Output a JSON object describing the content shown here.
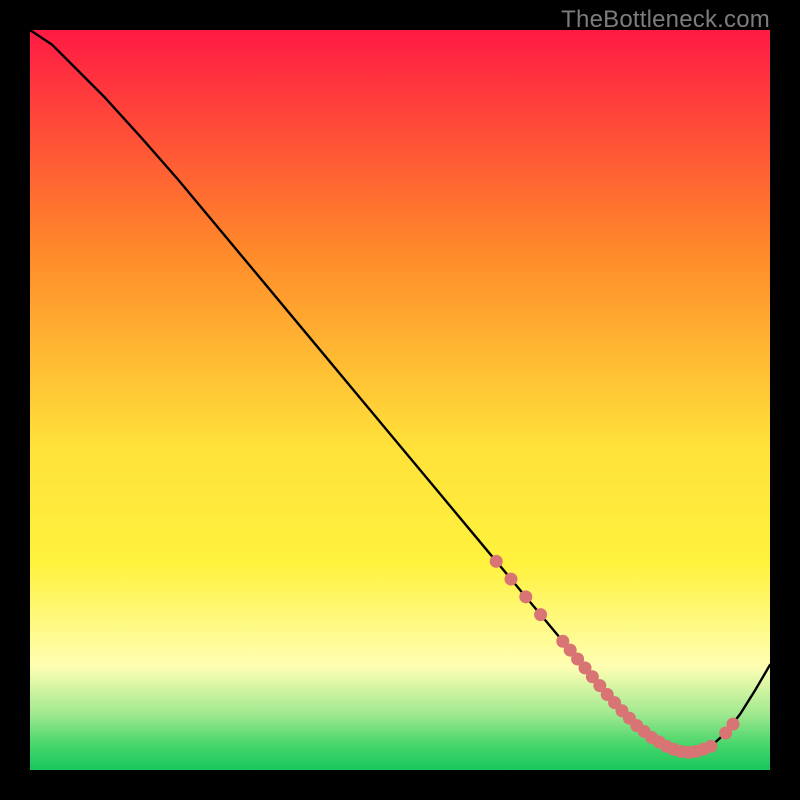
{
  "attribution": "TheBottleneck.com",
  "colors": {
    "black": "#000000",
    "line": "#000000",
    "marker_fill": "#d87474",
    "marker_stroke": "#d87474",
    "gradient_top": "#ff1a44",
    "gradient_mid1": "#ff8a2a",
    "gradient_mid2": "#ffe13a",
    "gradient_mid2b": "#fff23d",
    "gradient_pale": "#ffffb3",
    "gradient_green1": "#9fe88f",
    "gradient_green2": "#48d66b",
    "gradient_green3": "#18c85e"
  },
  "chart_data": {
    "type": "line",
    "title": "",
    "xlabel": "",
    "ylabel": "",
    "xlim": [
      0,
      100
    ],
    "ylim": [
      0,
      100
    ],
    "grid": false,
    "legend_position": "none",
    "series": [
      {
        "name": "bottleneck-curve",
        "x": [
          0,
          3,
          6,
          10,
          15,
          20,
          25,
          30,
          35,
          40,
          45,
          50,
          55,
          60,
          63,
          66,
          69,
          72,
          74,
          76,
          78,
          80,
          82,
          84,
          86,
          88,
          90,
          92,
          94,
          96,
          98,
          100
        ],
        "y": [
          100,
          98,
          95,
          91,
          85.5,
          79.8,
          73.8,
          67.8,
          61.8,
          55.8,
          49.8,
          43.8,
          37.8,
          31.8,
          28.2,
          24.6,
          21.0,
          17.4,
          15.0,
          12.6,
          10.2,
          8.0,
          6.0,
          4.4,
          3.2,
          2.5,
          2.5,
          3.2,
          5.0,
          7.6,
          10.8,
          14.2
        ]
      }
    ],
    "markers": {
      "name": "highlight-points",
      "x": [
        63,
        65,
        67,
        69,
        72,
        73,
        74,
        75,
        76,
        77,
        78,
        79,
        80,
        81,
        82,
        83,
        84,
        85,
        86,
        87,
        88,
        89,
        90,
        91,
        92,
        94,
        95
      ],
      "y": [
        28.2,
        25.8,
        23.4,
        21.0,
        17.4,
        16.2,
        15.0,
        13.8,
        12.6,
        11.4,
        10.2,
        9.1,
        8.0,
        7.0,
        6.0,
        5.2,
        4.4,
        3.8,
        3.2,
        2.8,
        2.5,
        2.4,
        2.5,
        2.8,
        3.2,
        5.0,
        6.2
      ]
    },
    "background": {
      "type": "vertical-gradient",
      "description": "red at top through orange, yellow, pale, to green at bottom indicating optimal zone"
    }
  }
}
